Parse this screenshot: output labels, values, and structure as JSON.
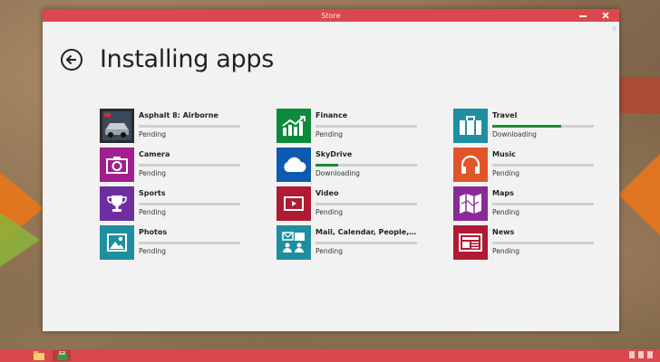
{
  "window": {
    "title": "Store"
  },
  "header": {
    "title": "Installing apps"
  },
  "apps": [
    {
      "name": "Asphalt 8: Airborne",
      "status": "Pending",
      "progress": 0,
      "color": "#2a2a2a",
      "icon": "car-icon"
    },
    {
      "name": "Camera",
      "status": "Pending",
      "progress": 0,
      "color": "#a11f8e",
      "icon": "camera-icon"
    },
    {
      "name": "Sports",
      "status": "Pending",
      "progress": 0,
      "color": "#6f2ea0",
      "icon": "trophy-icon"
    },
    {
      "name": "Photos",
      "status": "Pending",
      "progress": 0,
      "color": "#1e8fa0",
      "icon": "photo-icon"
    },
    {
      "name": "Finance",
      "status": "Pending",
      "progress": 0,
      "color": "#0d8a3c",
      "icon": "chart-icon"
    },
    {
      "name": "SkyDrive",
      "status": "Downloading",
      "progress": 0.22,
      "color": "#0d5ab0",
      "icon": "cloud-icon"
    },
    {
      "name": "Video",
      "status": "Pending",
      "progress": 0,
      "color": "#b01a33",
      "icon": "video-icon"
    },
    {
      "name": "Mail, Calendar, People, and...",
      "status": "Pending",
      "progress": 0,
      "color": "#1e8fa0",
      "icon": "mail-people-icon"
    },
    {
      "name": "Travel",
      "status": "Downloading",
      "progress": 0.68,
      "color": "#1e8fa0",
      "icon": "suitcase-icon"
    },
    {
      "name": "Music",
      "status": "Pending",
      "progress": 0,
      "color": "#e0562a",
      "icon": "headphones-icon"
    },
    {
      "name": "Maps",
      "status": "Pending",
      "progress": 0,
      "color": "#8a2a98",
      "icon": "map-icon"
    },
    {
      "name": "News",
      "status": "Pending",
      "progress": 0,
      "color": "#b01a33",
      "icon": "newspaper-icon"
    }
  ],
  "colors": {
    "accent": "#d9484d",
    "progress": "#1c8c2e"
  }
}
